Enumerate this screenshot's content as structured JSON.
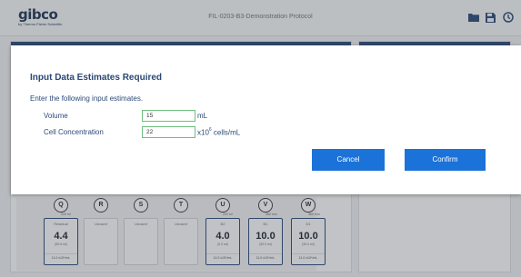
{
  "header": {
    "logo": "gibco",
    "logo_sub": "by Thermo Fisher Scientific",
    "title": "FIL-0203-B3-Demonstration Protocol",
    "icons": [
      "folder-icon",
      "save-icon",
      "settings-icon"
    ]
  },
  "vessels": [
    {
      "letter": "Q",
      "cap": "220 ml",
      "name": "Residual",
      "value": "4.4",
      "volume": "(50.6 ml)",
      "cells": "11.0 x10⁶/mL",
      "active": true
    },
    {
      "letter": "R",
      "cap": "",
      "name": "Unused",
      "value": "",
      "volume": "",
      "cells": "",
      "active": false
    },
    {
      "letter": "S",
      "cap": "",
      "name": "Unused",
      "value": "",
      "volume": "",
      "cells": "",
      "active": false
    },
    {
      "letter": "T",
      "cap": "",
      "name": "Unused",
      "value": "",
      "volume": "",
      "cells": "",
      "active": false
    },
    {
      "letter": "U",
      "cap": "220 ml",
      "name": "B2",
      "value": "4.0",
      "volume": "(0.2 ml)",
      "cells": "11.0 x10⁶/mL",
      "active": true
    },
    {
      "letter": "V",
      "cap": "360 mm",
      "name": "B1",
      "value": "10.0",
      "volume": "(30.0 ml)",
      "cells": "11.0 x10⁶/mL",
      "active": true
    },
    {
      "letter": "W",
      "cap": "360 mm",
      "name": "D1",
      "value": "10.0",
      "volume": "(30.0 ml)",
      "cells": "11.0 x10⁶/mL",
      "active": true
    }
  ],
  "dialog": {
    "title": "Input Data Estimates Required",
    "instruction": "Enter the following input estimates.",
    "volume_label": "Volume",
    "volume_value": "15",
    "volume_unit": "mL",
    "cell_label": "Cell Concentration",
    "cell_value": "22",
    "cell_unit_prefix": "x10",
    "cell_unit_exp": "6",
    "cell_unit_suffix": " cells/mL",
    "cancel_label": "Cancel",
    "confirm_label": "Confirm"
  },
  "colors": {
    "accent": "#1b72d8",
    "navy": "#2c4a78",
    "input_border": "#6cc07d"
  }
}
